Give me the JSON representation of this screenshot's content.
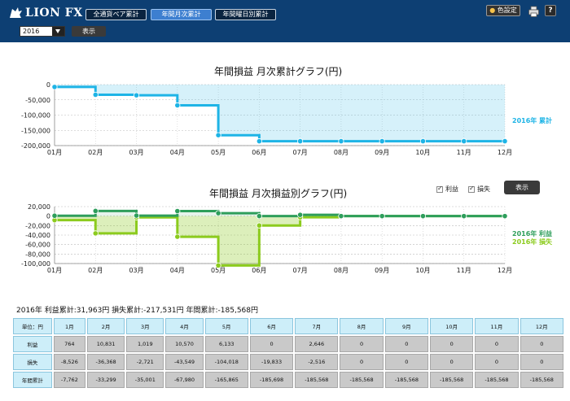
{
  "app": {
    "logo_text": "LION FX"
  },
  "tabs": [
    {
      "label": "全通貨ペア累計",
      "active": false
    },
    {
      "label": "年間月次累計",
      "active": true
    },
    {
      "label": "年間曜日別累計",
      "active": false
    }
  ],
  "controls": {
    "year": "2016",
    "show_label": "表示",
    "color_settings_label": "色設定",
    "help_label": "?"
  },
  "chart1": {
    "title": "年間損益 月次累計グラフ(円)",
    "series_label": "2016年 累計"
  },
  "chart2": {
    "title": "年間損益 月次損益別グラフ(円)",
    "legend_profit": "利益",
    "legend_loss": "損失",
    "show_label": "表示",
    "series_profit_label": "2016年 利益",
    "series_loss_label": "2016年 損失"
  },
  "summary_text": "2016年 利益累計:31,963円 損失累計:-217,531円 年間累計:-185,568円",
  "table": {
    "unit_label": "単位：円",
    "months": [
      "1月",
      "2月",
      "3月",
      "4月",
      "5月",
      "6月",
      "7月",
      "8月",
      "9月",
      "10月",
      "11月",
      "12月"
    ],
    "rows": [
      {
        "label": "利益",
        "values": [
          "764",
          "10,831",
          "1,019",
          "10,570",
          "6,133",
          "0",
          "2,646",
          "0",
          "0",
          "0",
          "0",
          "0"
        ]
      },
      {
        "label": "損失",
        "values": [
          "-8,526",
          "-36,368",
          "-2,721",
          "-43,549",
          "-104,018",
          "-19,833",
          "-2,516",
          "0",
          "0",
          "0",
          "0",
          "0"
        ]
      },
      {
        "label": "年間累計",
        "values": [
          "-7,762",
          "-33,299",
          "-35,001",
          "-67,980",
          "-165,865",
          "-185,698",
          "-185,568",
          "-185,568",
          "-185,568",
          "-185,568",
          "-185,568",
          "-185,568"
        ]
      }
    ]
  },
  "colors": {
    "cumulative": "#1eb4e6",
    "profit": "#2e9e5b",
    "loss": "#8ccb1e"
  },
  "chart_data": [
    {
      "type": "line",
      "title": "年間損益 月次累計グラフ(円)",
      "categories": [
        "01月",
        "02月",
        "03月",
        "04月",
        "05月",
        "06月",
        "07月",
        "08月",
        "09月",
        "10月",
        "11月",
        "12月"
      ],
      "series": [
        {
          "name": "2016年 累計",
          "values": [
            -7762,
            -33299,
            -35001,
            -67980,
            -165865,
            -185698,
            -185568,
            -185568,
            -185568,
            -185568,
            -185568,
            -185568
          ]
        }
      ],
      "y_ticks": [
        "0",
        "-50,000",
        "-100,000",
        "-150,000",
        "-200,000"
      ],
      "ylim": [
        -200000,
        0
      ]
    },
    {
      "type": "line",
      "title": "年間損益 月次損益別グラフ(円)",
      "categories": [
        "01月",
        "02月",
        "03月",
        "04月",
        "05月",
        "06月",
        "07月",
        "08月",
        "09月",
        "10月",
        "11月",
        "12月"
      ],
      "series": [
        {
          "name": "2016年 利益",
          "values": [
            764,
            10831,
            1019,
            10570,
            6133,
            0,
            2646,
            0,
            0,
            0,
            0,
            0
          ]
        },
        {
          "name": "2016年 損失",
          "values": [
            -8526,
            -36368,
            -2721,
            -43549,
            -104018,
            -19833,
            -2516,
            0,
            0,
            0,
            0,
            0
          ]
        }
      ],
      "y_ticks": [
        "20,000",
        "0",
        "-20,000",
        "-40,000",
        "-60,000",
        "-80,000",
        "-100,000"
      ],
      "ylim": [
        -100000,
        20000
      ]
    }
  ]
}
